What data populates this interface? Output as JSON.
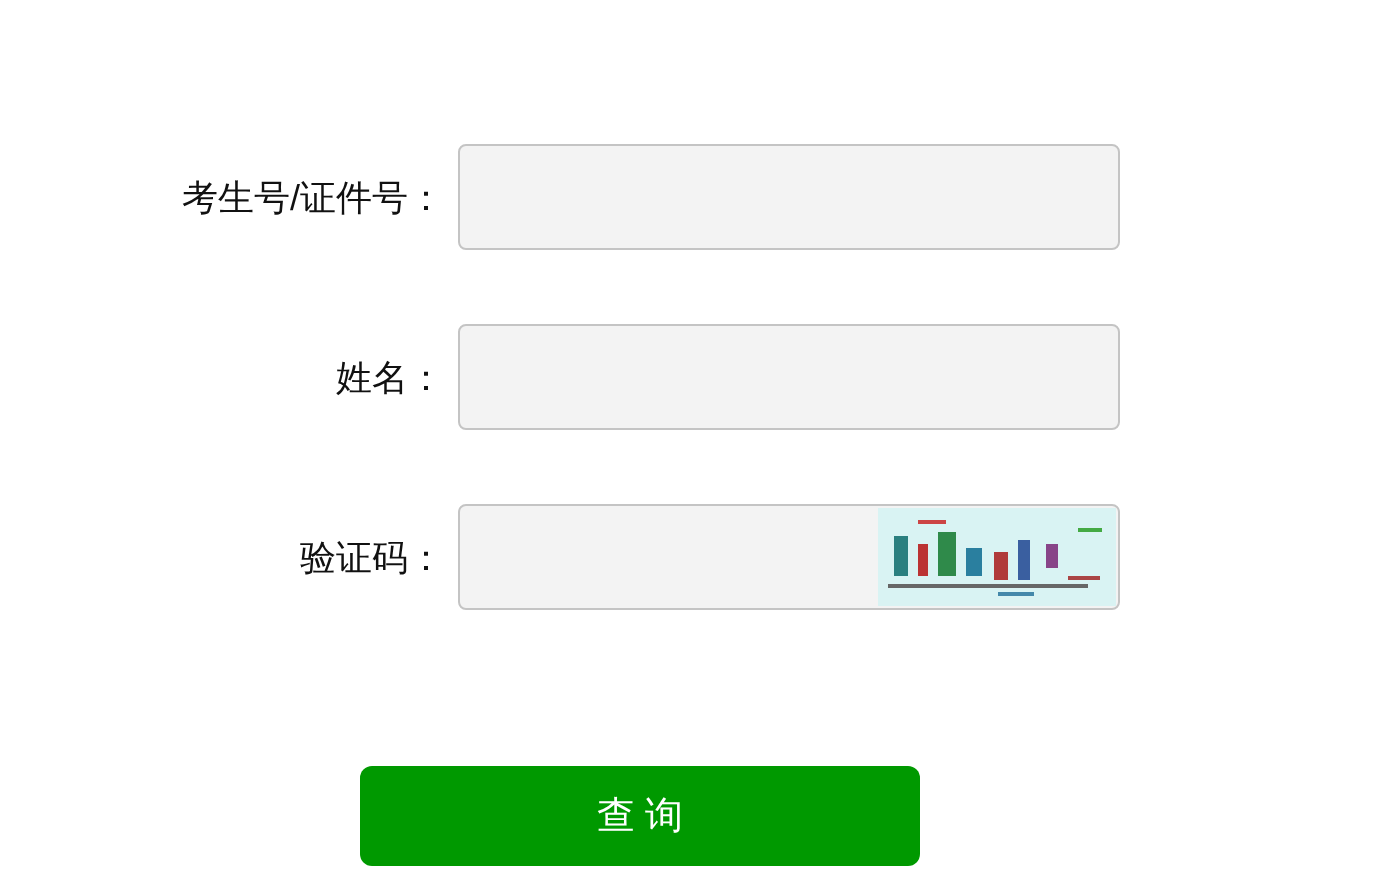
{
  "fields": [
    {
      "label": "考生号/证件号：",
      "captcha": false
    },
    {
      "label": "姓名：",
      "captcha": false
    },
    {
      "label": "验证码：",
      "captcha": true
    }
  ],
  "button": {
    "label": "查 询"
  }
}
